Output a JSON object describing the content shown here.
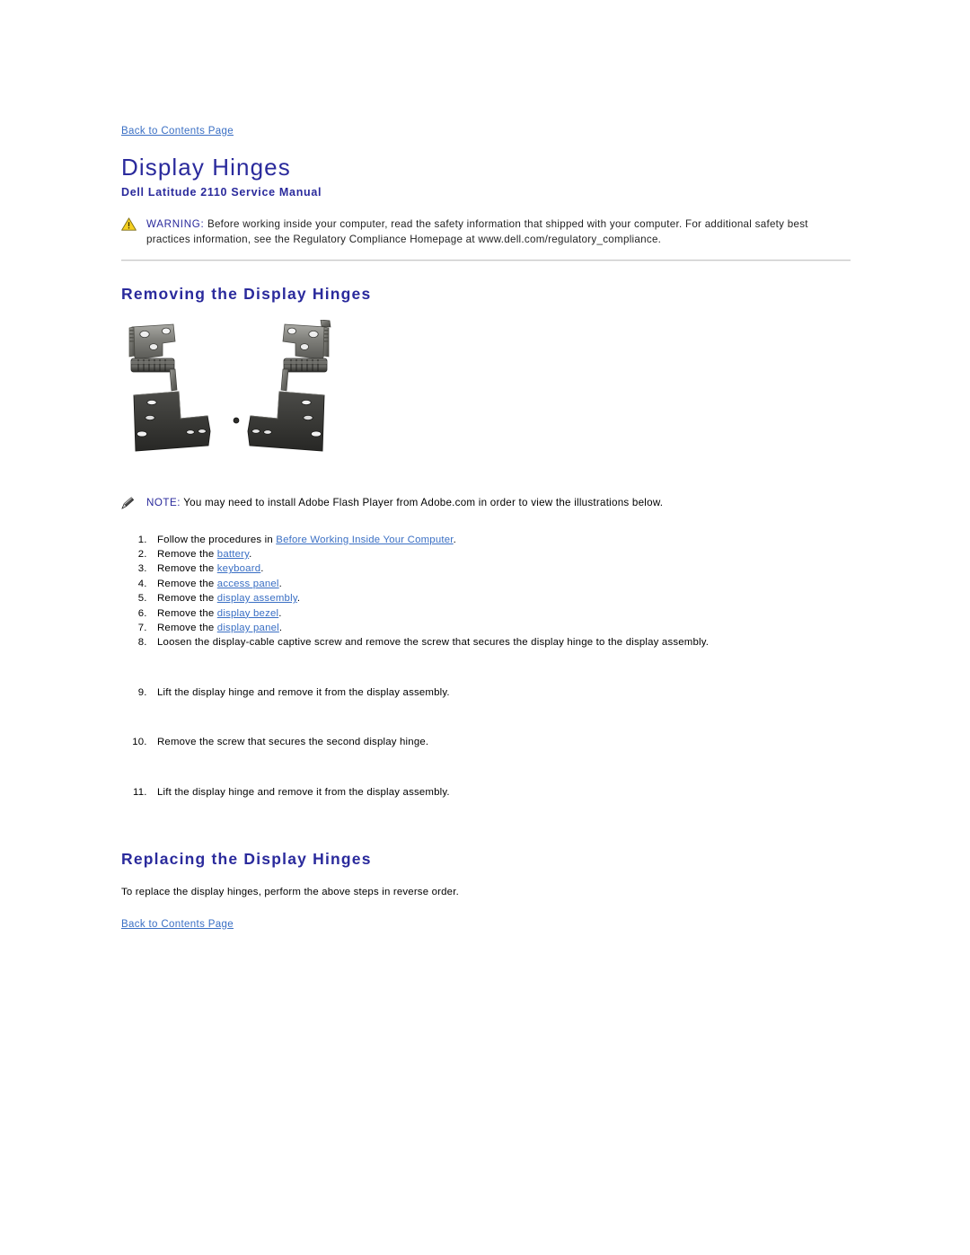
{
  "document": {
    "top_link": "Back to Contents Page",
    "title": "Display Hinges",
    "subtitle": "Dell Latitude 2110 Service Manual",
    "bottom_link": "Back to Contents Page"
  },
  "warning": {
    "icon": "warning-triangle-icon",
    "label": "WARNING:",
    "text": " Before working inside your computer, read the safety information that shipped with your computer. For additional safety best practices information, see the Regulatory Compliance Homepage at www.dell.com/regulatory_compliance."
  },
  "note": {
    "icon": "note-pencil-icon",
    "label": "NOTE:",
    "text": " You may need to install Adobe Flash Player from Adobe.com in order to view the illustrations below."
  },
  "sections": {
    "removing_title": "Removing the Display Hinges",
    "replacing_title": "Replacing the Display Hinges",
    "replacing_text": "To replace the display hinges, perform the above steps in reverse order."
  },
  "figure": {
    "alt": "Two display hinges, left and right, metal brackets"
  },
  "steps": [
    {
      "pre": "Follow the procedures in ",
      "link": "Before Working Inside Your Computer",
      "post": "."
    },
    {
      "pre": "Remove the ",
      "link": "battery",
      "post": "."
    },
    {
      "pre": "Remove the ",
      "link": "keyboard",
      "post": "."
    },
    {
      "pre": "Remove the ",
      "link": "access panel",
      "post": "."
    },
    {
      "pre": "Remove the ",
      "link": "display assembly",
      "post": "."
    },
    {
      "pre": "Remove the ",
      "link": "display bezel",
      "post": "."
    },
    {
      "pre": "Remove the ",
      "link": "display panel",
      "post": "."
    },
    {
      "pre": "Loosen the display-cable captive screw and remove the screw that secures the display hinge to the display assembly.",
      "link": "",
      "post": ""
    },
    {
      "pre": "Lift the display hinge and remove it from the display assembly.",
      "link": "",
      "post": ""
    },
    {
      "pre": "Remove the screw that secures the second display hinge.",
      "link": "",
      "post": ""
    },
    {
      "pre": "Lift the display hinge and remove it from the display assembly.",
      "link": "",
      "post": ""
    }
  ],
  "colors": {
    "heading_blue": "#2a2a9c",
    "link_blue": "#3a6fc4",
    "warning_yellow": "#f5d020",
    "divider_gray": "#c8c8c8",
    "body_text": "#222222"
  }
}
